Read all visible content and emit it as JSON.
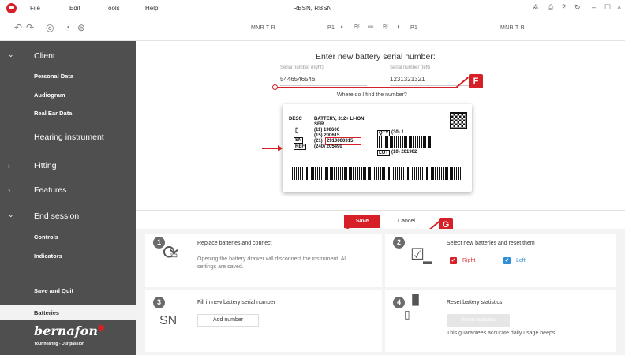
{
  "menu": {
    "file": "File",
    "edit": "Edit",
    "tools": "Tools",
    "help": "Help"
  },
  "window_title": "RBSN, RBSN",
  "toolbar": {
    "left_program": "MNR T R",
    "right_program": "MNR T R",
    "p1_left": "P1",
    "p1_right": "P1"
  },
  "sidebar": {
    "client": "Client",
    "client_items": [
      "Personal Data",
      "Audiogram",
      "Real Ear Data"
    ],
    "hearing_instrument": "Hearing instrument",
    "fitting": "Fitting",
    "features": "Features",
    "end_session": "End session",
    "end_items": [
      "Controls",
      "Indicators",
      "Batteries",
      "Save and Quit"
    ],
    "brand": "bernafon",
    "tagline": "Your hearing - Our passion"
  },
  "main": {
    "heading": "Enter new battery serial number:",
    "right_label": "Serial number (right)",
    "right_value": "5446546546",
    "left_label": "Serial number (left)",
    "left_value": "1231321321",
    "find_link": "Where do I find the number?",
    "save": "Save",
    "cancel": "Cancel",
    "callout_f": "F",
    "callout_g": "G"
  },
  "label": {
    "desc": "DESC",
    "product": "BATTERY, 312+ LI-ION",
    "ser": "SER",
    "l1": "(11) 190606",
    "l2": "(15) 200615",
    "l3": "(21)",
    "sn_value": "2910000315",
    "l4": "(240) 205490",
    "sn": "SN",
    "ref": "REF",
    "qty": "QTY",
    "qty_val": "(30) 1",
    "lot": "LOT",
    "lot_val": "(10) 201902"
  },
  "steps": [
    {
      "num": "1",
      "title": "Replace batteries and connect",
      "desc": "Opening the battery drawer will disconnect the instrument. All settings are saved."
    },
    {
      "num": "2",
      "title": "Select new batteries and reset them",
      "right": "Right",
      "left": "Left"
    },
    {
      "num": "3",
      "title": "Fill in new battery serial number",
      "button": "Add number",
      "icon_text": "SN"
    },
    {
      "num": "4",
      "title": "Reset battery statistics",
      "button": "Reset statistics",
      "desc": "This guarantees accurate daily usage beeps."
    }
  ],
  "colors": {
    "accent": "#d61f26",
    "sidebar": "#4f4f4f",
    "left_check": "#2f8fd6"
  }
}
